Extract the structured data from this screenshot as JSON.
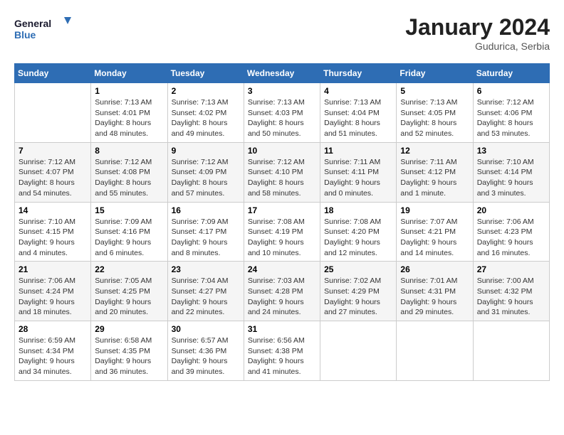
{
  "logo": {
    "line1": "General",
    "line2": "Blue"
  },
  "title": "January 2024",
  "subtitle": "Gudurica, Serbia",
  "days_header": [
    "Sunday",
    "Monday",
    "Tuesday",
    "Wednesday",
    "Thursday",
    "Friday",
    "Saturday"
  ],
  "weeks": [
    [
      {
        "day": "",
        "sunrise": "",
        "sunset": "",
        "daylight": ""
      },
      {
        "day": "1",
        "sunrise": "Sunrise: 7:13 AM",
        "sunset": "Sunset: 4:01 PM",
        "daylight": "Daylight: 8 hours and 48 minutes."
      },
      {
        "day": "2",
        "sunrise": "Sunrise: 7:13 AM",
        "sunset": "Sunset: 4:02 PM",
        "daylight": "Daylight: 8 hours and 49 minutes."
      },
      {
        "day": "3",
        "sunrise": "Sunrise: 7:13 AM",
        "sunset": "Sunset: 4:03 PM",
        "daylight": "Daylight: 8 hours and 50 minutes."
      },
      {
        "day": "4",
        "sunrise": "Sunrise: 7:13 AM",
        "sunset": "Sunset: 4:04 PM",
        "daylight": "Daylight: 8 hours and 51 minutes."
      },
      {
        "day": "5",
        "sunrise": "Sunrise: 7:13 AM",
        "sunset": "Sunset: 4:05 PM",
        "daylight": "Daylight: 8 hours and 52 minutes."
      },
      {
        "day": "6",
        "sunrise": "Sunrise: 7:12 AM",
        "sunset": "Sunset: 4:06 PM",
        "daylight": "Daylight: 8 hours and 53 minutes."
      }
    ],
    [
      {
        "day": "7",
        "sunrise": "Sunrise: 7:12 AM",
        "sunset": "Sunset: 4:07 PM",
        "daylight": "Daylight: 8 hours and 54 minutes."
      },
      {
        "day": "8",
        "sunrise": "Sunrise: 7:12 AM",
        "sunset": "Sunset: 4:08 PM",
        "daylight": "Daylight: 8 hours and 55 minutes."
      },
      {
        "day": "9",
        "sunrise": "Sunrise: 7:12 AM",
        "sunset": "Sunset: 4:09 PM",
        "daylight": "Daylight: 8 hours and 57 minutes."
      },
      {
        "day": "10",
        "sunrise": "Sunrise: 7:12 AM",
        "sunset": "Sunset: 4:10 PM",
        "daylight": "Daylight: 8 hours and 58 minutes."
      },
      {
        "day": "11",
        "sunrise": "Sunrise: 7:11 AM",
        "sunset": "Sunset: 4:11 PM",
        "daylight": "Daylight: 9 hours and 0 minutes."
      },
      {
        "day": "12",
        "sunrise": "Sunrise: 7:11 AM",
        "sunset": "Sunset: 4:12 PM",
        "daylight": "Daylight: 9 hours and 1 minute."
      },
      {
        "day": "13",
        "sunrise": "Sunrise: 7:10 AM",
        "sunset": "Sunset: 4:14 PM",
        "daylight": "Daylight: 9 hours and 3 minutes."
      }
    ],
    [
      {
        "day": "14",
        "sunrise": "Sunrise: 7:10 AM",
        "sunset": "Sunset: 4:15 PM",
        "daylight": "Daylight: 9 hours and 4 minutes."
      },
      {
        "day": "15",
        "sunrise": "Sunrise: 7:09 AM",
        "sunset": "Sunset: 4:16 PM",
        "daylight": "Daylight: 9 hours and 6 minutes."
      },
      {
        "day": "16",
        "sunrise": "Sunrise: 7:09 AM",
        "sunset": "Sunset: 4:17 PM",
        "daylight": "Daylight: 9 hours and 8 minutes."
      },
      {
        "day": "17",
        "sunrise": "Sunrise: 7:08 AM",
        "sunset": "Sunset: 4:19 PM",
        "daylight": "Daylight: 9 hours and 10 minutes."
      },
      {
        "day": "18",
        "sunrise": "Sunrise: 7:08 AM",
        "sunset": "Sunset: 4:20 PM",
        "daylight": "Daylight: 9 hours and 12 minutes."
      },
      {
        "day": "19",
        "sunrise": "Sunrise: 7:07 AM",
        "sunset": "Sunset: 4:21 PM",
        "daylight": "Daylight: 9 hours and 14 minutes."
      },
      {
        "day": "20",
        "sunrise": "Sunrise: 7:06 AM",
        "sunset": "Sunset: 4:23 PM",
        "daylight": "Daylight: 9 hours and 16 minutes."
      }
    ],
    [
      {
        "day": "21",
        "sunrise": "Sunrise: 7:06 AM",
        "sunset": "Sunset: 4:24 PM",
        "daylight": "Daylight: 9 hours and 18 minutes."
      },
      {
        "day": "22",
        "sunrise": "Sunrise: 7:05 AM",
        "sunset": "Sunset: 4:25 PM",
        "daylight": "Daylight: 9 hours and 20 minutes."
      },
      {
        "day": "23",
        "sunrise": "Sunrise: 7:04 AM",
        "sunset": "Sunset: 4:27 PM",
        "daylight": "Daylight: 9 hours and 22 minutes."
      },
      {
        "day": "24",
        "sunrise": "Sunrise: 7:03 AM",
        "sunset": "Sunset: 4:28 PM",
        "daylight": "Daylight: 9 hours and 24 minutes."
      },
      {
        "day": "25",
        "sunrise": "Sunrise: 7:02 AM",
        "sunset": "Sunset: 4:29 PM",
        "daylight": "Daylight: 9 hours and 27 minutes."
      },
      {
        "day": "26",
        "sunrise": "Sunrise: 7:01 AM",
        "sunset": "Sunset: 4:31 PM",
        "daylight": "Daylight: 9 hours and 29 minutes."
      },
      {
        "day": "27",
        "sunrise": "Sunrise: 7:00 AM",
        "sunset": "Sunset: 4:32 PM",
        "daylight": "Daylight: 9 hours and 31 minutes."
      }
    ],
    [
      {
        "day": "28",
        "sunrise": "Sunrise: 6:59 AM",
        "sunset": "Sunset: 4:34 PM",
        "daylight": "Daylight: 9 hours and 34 minutes."
      },
      {
        "day": "29",
        "sunrise": "Sunrise: 6:58 AM",
        "sunset": "Sunset: 4:35 PM",
        "daylight": "Daylight: 9 hours and 36 minutes."
      },
      {
        "day": "30",
        "sunrise": "Sunrise: 6:57 AM",
        "sunset": "Sunset: 4:36 PM",
        "daylight": "Daylight: 9 hours and 39 minutes."
      },
      {
        "day": "31",
        "sunrise": "Sunrise: 6:56 AM",
        "sunset": "Sunset: 4:38 PM",
        "daylight": "Daylight: 9 hours and 41 minutes."
      },
      {
        "day": "",
        "sunrise": "",
        "sunset": "",
        "daylight": ""
      },
      {
        "day": "",
        "sunrise": "",
        "sunset": "",
        "daylight": ""
      },
      {
        "day": "",
        "sunrise": "",
        "sunset": "",
        "daylight": ""
      }
    ]
  ]
}
